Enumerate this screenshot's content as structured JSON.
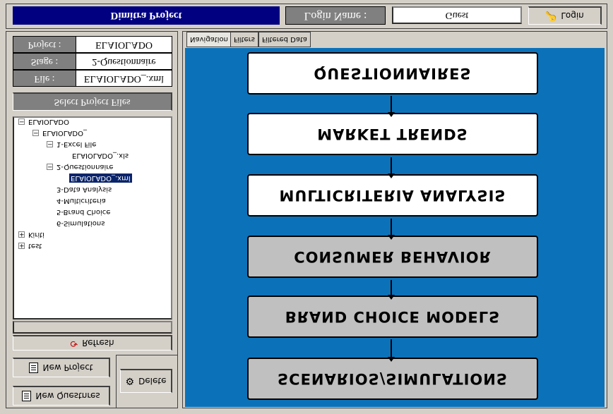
{
  "toolbar": {
    "new_questionnaire": "New Questnres",
    "new_project": "New Project",
    "delete": "Delete",
    "refresh": "Refresh"
  },
  "tree": {
    "nodes": [
      "test",
      "Kiriti",
      "6-Simulations",
      "5-Brand Choice",
      "4-Multicriteria",
      "3-Data Analysis",
      "ELAIOLADO_.xml",
      "2-Questionnaire",
      "ELAIOLADO_.xls",
      "1-Excel File",
      "ELAIOLADO_",
      "ELAIOLADO"
    ]
  },
  "select_files_button": "Select Project Files",
  "info": {
    "file_label": "File :",
    "file_value": "ELAIOLADO_.xml",
    "stage_label": "Stage :",
    "stage_value": "2-Questionnaire",
    "project_label": "Project :",
    "project_value": "ELAIOLADO"
  },
  "diagram": {
    "stages": [
      "SCENARIOS/SIMULATIONS",
      "BRAND CHOICE MODELS",
      "CONSUMER BEHAVIOR",
      "MULTICRITERIA ANALYSIS",
      "MARKET TRENDS",
      "QUESTIONNAIRES"
    ],
    "canvas_color": "#0b72b9"
  },
  "tabs": [
    "Navigation",
    "Filters",
    "Filtered Data"
  ],
  "status": {
    "app_title": "Dimitra Project",
    "login_name_label": "Login Name :",
    "login_name_value": "Guest",
    "login_button": "Login"
  }
}
